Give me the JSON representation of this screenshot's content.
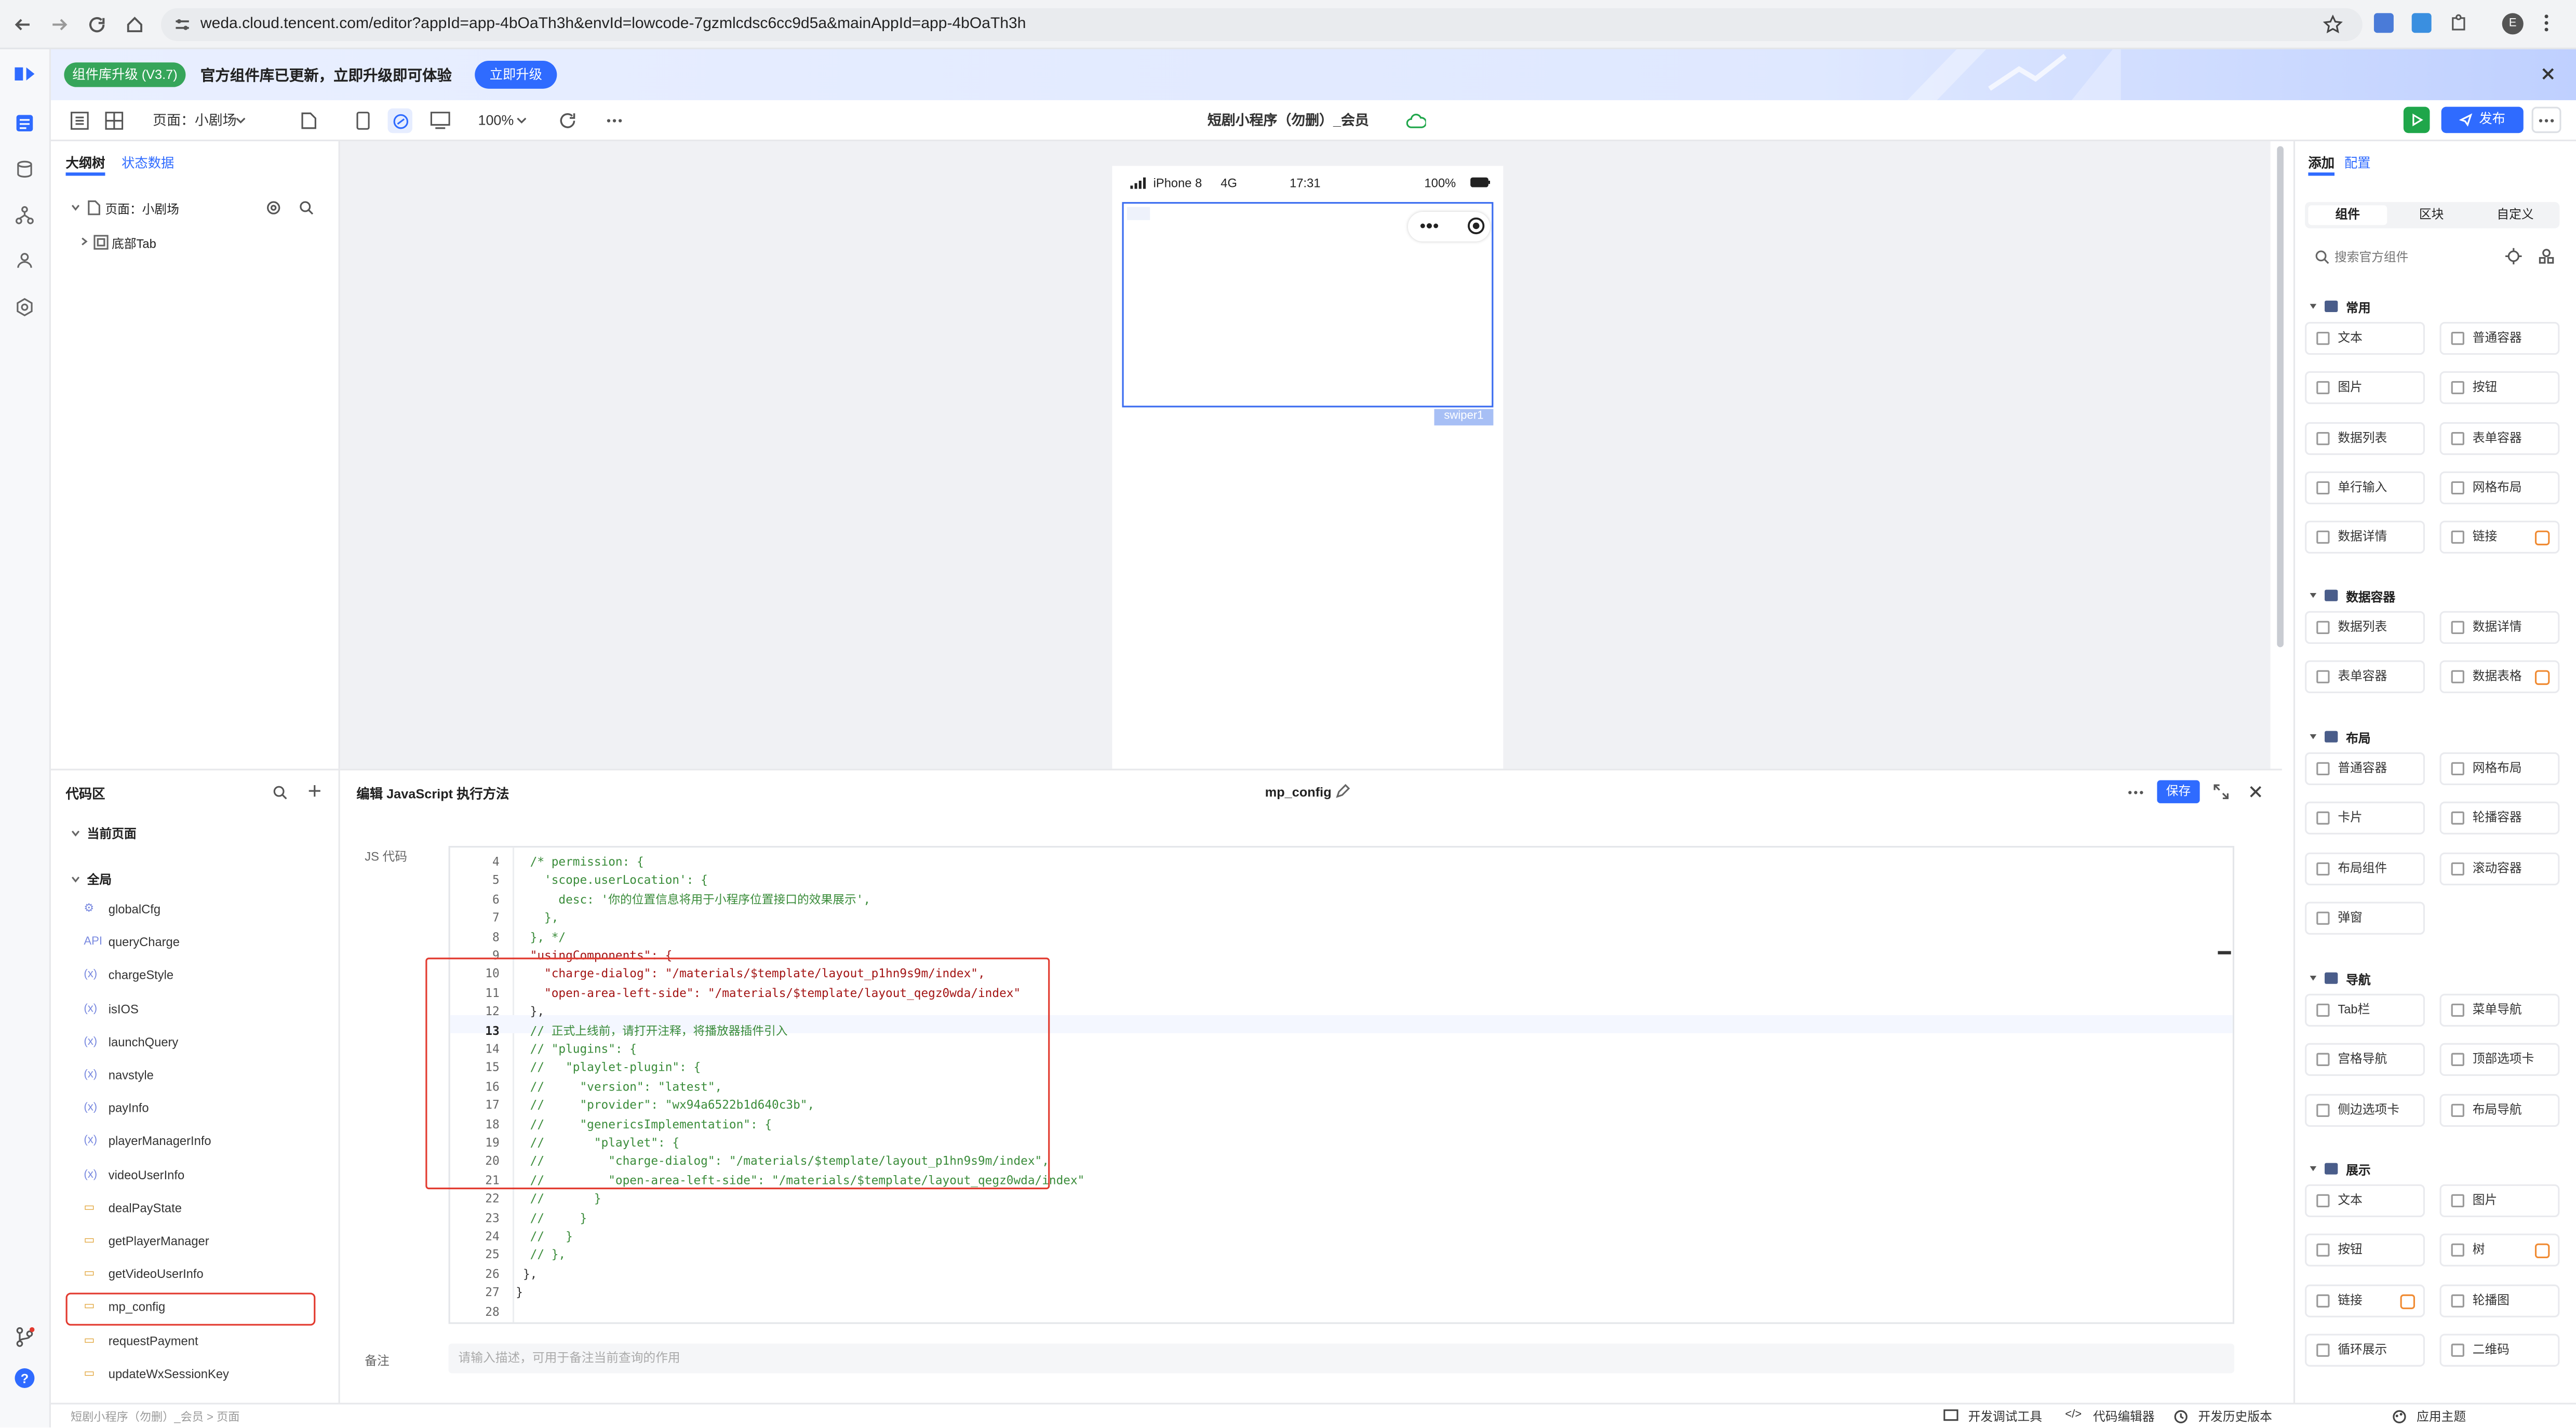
{
  "browser": {
    "url": "weda.cloud.tencent.com/editor?appId=app-4bOaTh3h&envId=lowcode-7gzmlcdsc6cc9d5a&mainAppId=app-4bOaTh3h",
    "profile_initial": "E"
  },
  "banner": {
    "badge": "组件库升级 (V3.7)",
    "text": "官方组件库已更新，立即升级即可体验",
    "button": "立即升级"
  },
  "toolbar": {
    "page_select": "页面：小剧场",
    "zoom": "100%",
    "app_title": "短剧小程序（勿删）_会员",
    "publish": "发布"
  },
  "outline": {
    "tabs": [
      "大纲树",
      "状态数据"
    ],
    "page_node": "页面：小剧场",
    "child_node": "底部Tab"
  },
  "phone": {
    "model": "iPhone 8",
    "network": "4G",
    "time": "17:31",
    "battery": "100%",
    "selected_tag": "swiper1"
  },
  "right_panel": {
    "tabs": [
      "添加",
      "配置"
    ],
    "subtabs": [
      "组件",
      "区块",
      "自定义"
    ],
    "search_placeholder": "搜索官方组件",
    "categories": [
      {
        "name": "常用",
        "items": [
          "文本",
          "普通容器",
          "图片",
          "按钮",
          "数据列表",
          "表单容器",
          "单行输入",
          "网格布局",
          "数据详情",
          "链接"
        ]
      },
      {
        "name": "数据容器",
        "items": [
          "数据列表",
          "数据详情",
          "表单容器",
          "数据表格"
        ]
      },
      {
        "name": "布局",
        "items": [
          "普通容器",
          "网格布局",
          "卡片",
          "轮播容器",
          "布局组件",
          "滚动容器",
          "弹窗"
        ]
      },
      {
        "name": "导航",
        "items": [
          "Tab栏",
          "菜单导航",
          "宫格导航",
          "顶部选项卡",
          "侧边选项卡",
          "布局导航"
        ]
      },
      {
        "name": "展示",
        "items": [
          "文本",
          "图片",
          "按钮",
          "树",
          "链接",
          "轮播图",
          "循环展示",
          "二维码"
        ]
      }
    ]
  },
  "code_area": {
    "title": "代码区",
    "current_page": "当前页面",
    "global": "全局",
    "items": [
      "globalCfg",
      "queryCharge",
      "chargeStyle",
      "isIOS",
      "launchQuery",
      "navstyle",
      "payInfo",
      "playerManagerInfo",
      "videoUserInfo",
      "dealPayState",
      "getPlayerManager",
      "getVideoUserInfo",
      "mp_config",
      "requestPayment",
      "updateWxSessionKey"
    ],
    "item_types": [
      "cfg",
      "api",
      "var",
      "var",
      "var",
      "var",
      "var",
      "var",
      "var",
      "fn",
      "fn",
      "fn",
      "fn",
      "fn",
      "fn"
    ]
  },
  "editor": {
    "header": "编辑 JavaScript 执行方法",
    "method_name": "mp_config",
    "save": "保存",
    "js_label": "JS 代码",
    "remark_label": "备注",
    "remark_placeholder": "请输入描述，可用于备注当前查询的作用",
    "lines": [
      {
        "n": "4",
        "t": "  /* permission: {"
      },
      {
        "n": "5",
        "t": "    'scope.userLocation': {"
      },
      {
        "n": "6",
        "t": "      desc: '你的位置信息将用于小程序位置接口的效果展示',"
      },
      {
        "n": "7",
        "t": "    },"
      },
      {
        "n": "8",
        "t": "  }, */"
      },
      {
        "n": "9",
        "t": "  \"usingComponents\": {"
      },
      {
        "n": "10",
        "t": "    \"charge-dialog\": \"/materials/$template/layout_p1hn9s9m/index\","
      },
      {
        "n": "11",
        "t": "    \"open-area-left-side\": \"/materials/$template/layout_qegz0wda/index\""
      },
      {
        "n": "12",
        "t": "  },"
      },
      {
        "n": "13",
        "t": "  // 正式上线前，请打开注释，将播放器插件引入"
      },
      {
        "n": "14",
        "t": "  // \"plugins\": {"
      },
      {
        "n": "15",
        "t": "  //   \"playlet-plugin\": {"
      },
      {
        "n": "16",
        "t": "  //     \"version\": \"latest\","
      },
      {
        "n": "17",
        "t": "  //     \"provider\": \"wx94a6522b1d640c3b\","
      },
      {
        "n": "18",
        "t": "  //     \"genericsImplementation\": {"
      },
      {
        "n": "19",
        "t": "  //       \"playlet\": {"
      },
      {
        "n": "20",
        "t": "  //         \"charge-dialog\": \"/materials/$template/layout_p1hn9s9m/index\","
      },
      {
        "n": "21",
        "t": "  //         \"open-area-left-side\": \"/materials/$template/layout_qegz0wda/index\""
      },
      {
        "n": "22",
        "t": "  //       }"
      },
      {
        "n": "23",
        "t": "  //     }"
      },
      {
        "n": "24",
        "t": "  //   }"
      },
      {
        "n": "25",
        "t": "  // },"
      },
      {
        "n": "26",
        "t": " },"
      },
      {
        "n": "27",
        "t": "}"
      },
      {
        "n": "28",
        "t": ""
      }
    ]
  },
  "status": {
    "breadcrumb": "短剧小程序（勿删）_会员  >  页面",
    "dev_tools": "开发调试工具",
    "code_editor": "代码编辑器",
    "history": "开发历史版本",
    "theme": "应用主题"
  },
  "colors": {
    "accent": "#2f6bff",
    "run_green": "#1fa64a",
    "highlight_red": "#e23a2f"
  }
}
